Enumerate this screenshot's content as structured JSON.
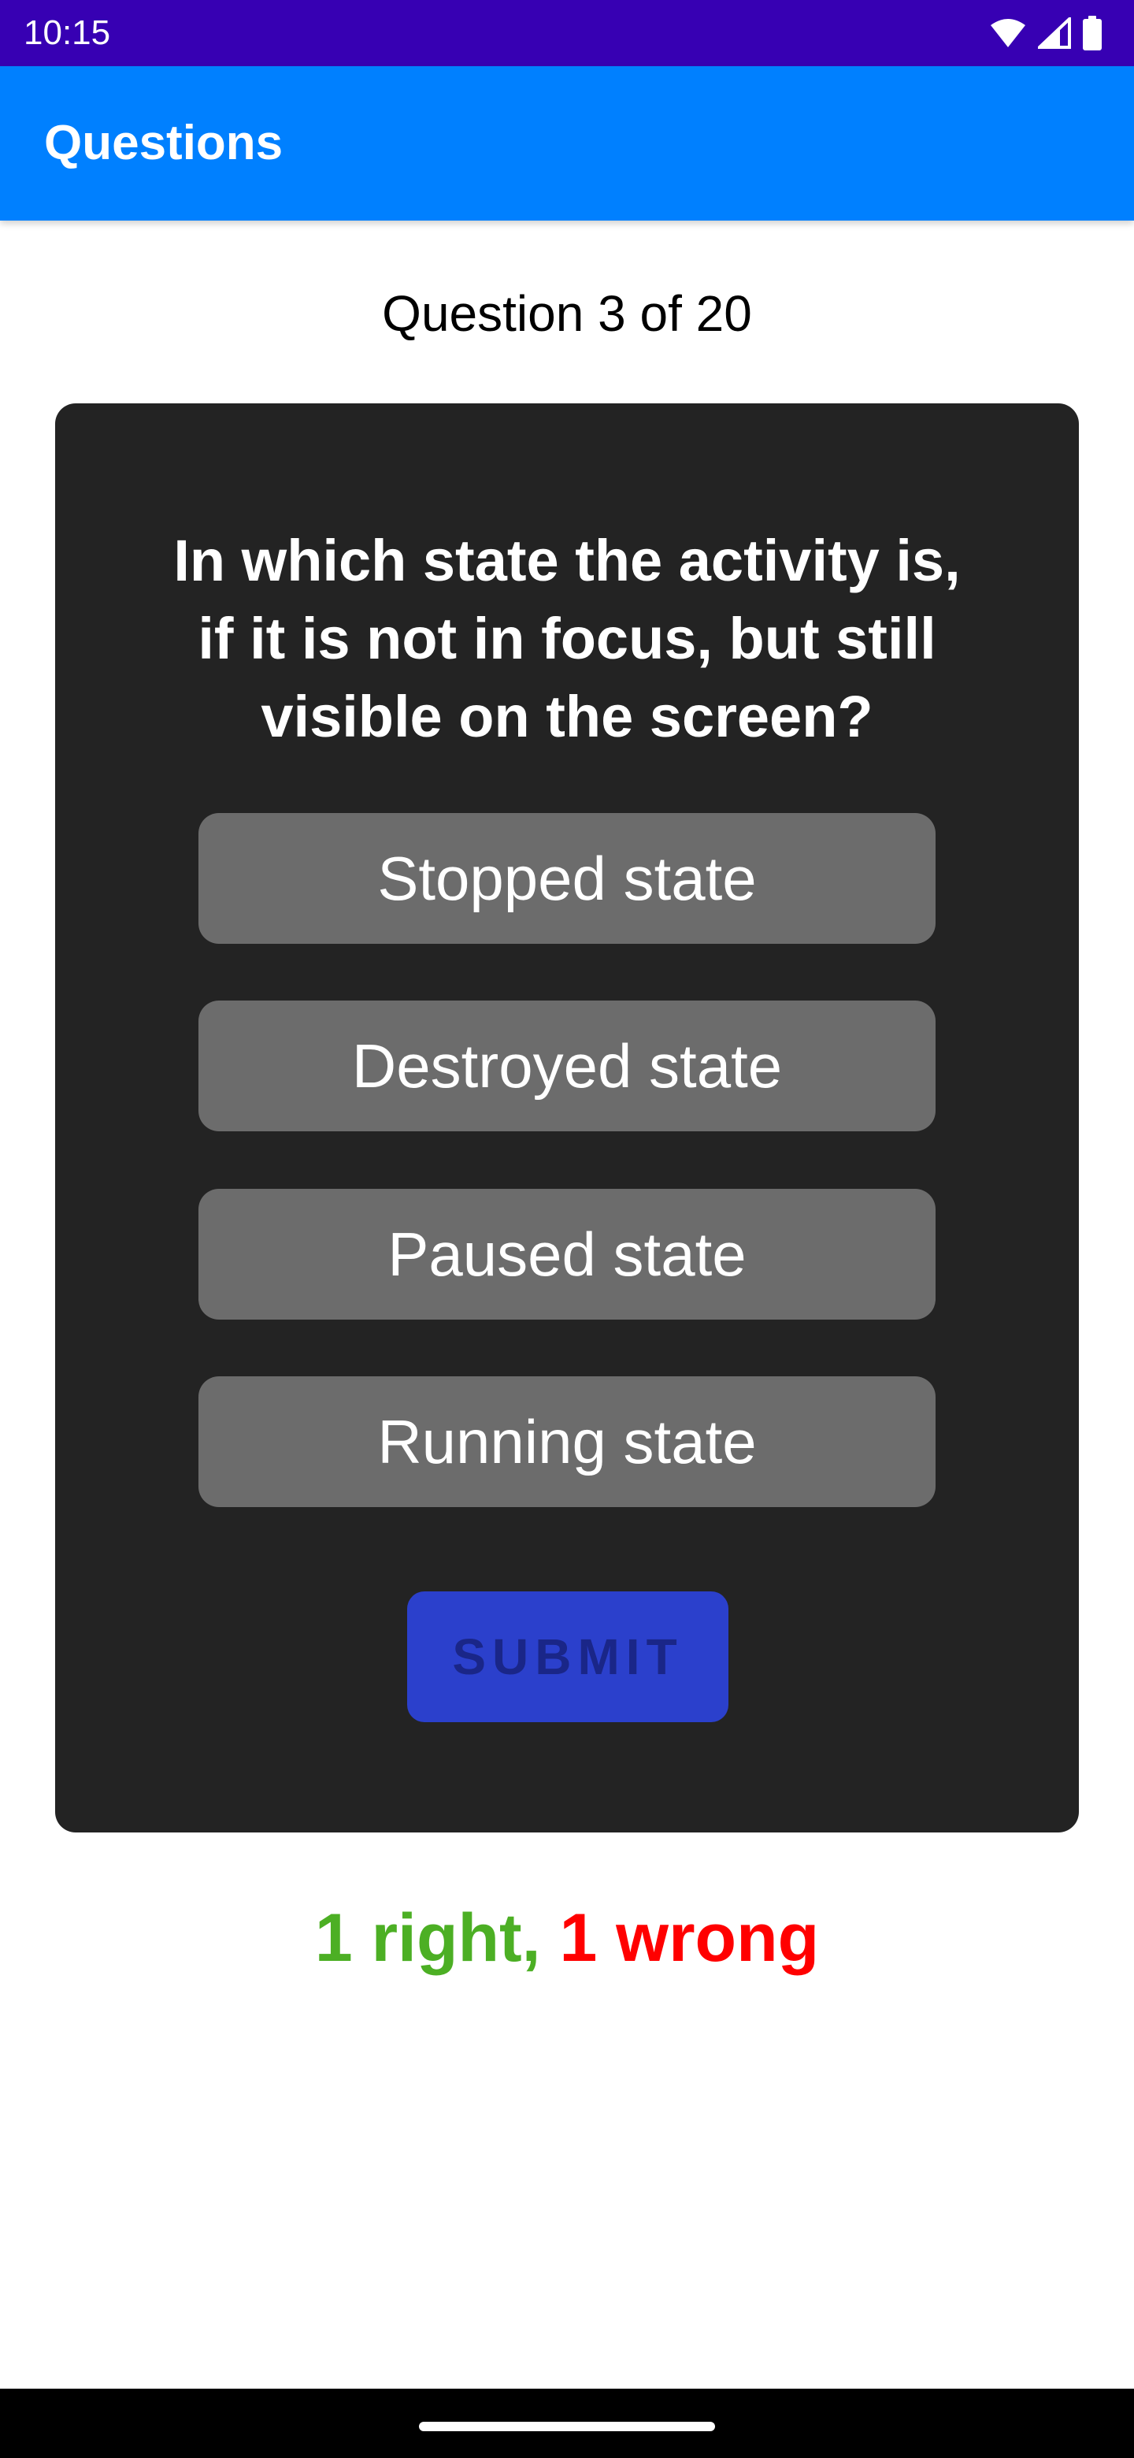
{
  "status_bar": {
    "time": "10:15",
    "icons": [
      "wifi-icon",
      "signal-icon",
      "battery-icon"
    ],
    "background": "#3700b3"
  },
  "app_bar": {
    "title": "Questions",
    "background": "#0080ff"
  },
  "progress": {
    "text": "Question 3 of 20"
  },
  "quiz": {
    "question": "In which state the activity is, if it is not in focus, but still visible on the screen?",
    "options": [
      {
        "label": "Stopped state"
      },
      {
        "label": "Destroyed state"
      },
      {
        "label": "Paused state"
      },
      {
        "label": "Running state"
      }
    ],
    "submit_label": "SUBMIT",
    "card_color": "#232323",
    "option_color": "#6c6c6c",
    "submit_color": "#2b40cc"
  },
  "score": {
    "right_text": "1 right,",
    "wrong_text": "1 wrong",
    "right_color": "#4caf24",
    "wrong_color": "#ff0000"
  }
}
